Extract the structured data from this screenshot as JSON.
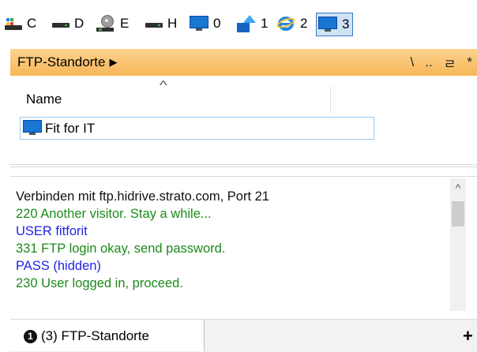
{
  "drives": [
    {
      "letter": "C",
      "icon": "system-drive-icon"
    },
    {
      "letter": "D",
      "icon": "hard-drive-icon"
    },
    {
      "letter": "E",
      "icon": "network-drive-icon"
    },
    {
      "letter": "H",
      "icon": "hard-drive-icon"
    },
    {
      "letter": "0",
      "icon": "desktop-icon"
    },
    {
      "letter": "1",
      "icon": "network-share-icon"
    },
    {
      "letter": "2",
      "icon": "internet-explorer-icon"
    },
    {
      "letter": "3",
      "icon": "computer-icon",
      "active": true
    }
  ],
  "path": {
    "crumb": "FTP-Standorte",
    "arrow": "▶",
    "tools": [
      "\\",
      "..",
      "ㄹ",
      "*"
    ]
  },
  "list": {
    "column_name": "Name",
    "items": [
      {
        "label": "Fit for IT",
        "icon": "monitor-icon"
      }
    ]
  },
  "log": [
    {
      "text": "Verbinden mit ftp.hidrive.strato.com, Port 21",
      "color": "#111111"
    },
    {
      "text": "220 Another visitor. Stay a while...",
      "color": "#1c8a1c"
    },
    {
      "text": "USER fitforit",
      "color": "#2222ee"
    },
    {
      "text": "331 FTP login okay, send password.",
      "color": "#1c8a1c"
    },
    {
      "text": "PASS (hidden)",
      "color": "#2222ee"
    },
    {
      "text": "230 User logged in, proceed.",
      "color": "#1c8a1c"
    }
  ],
  "tabs": [
    {
      "badge": "1",
      "label": "(3) FTP-Standorte"
    }
  ],
  "tab_add": "+",
  "colors": {
    "pathbar": "#f7b657",
    "selection_border": "#99c9ef"
  }
}
